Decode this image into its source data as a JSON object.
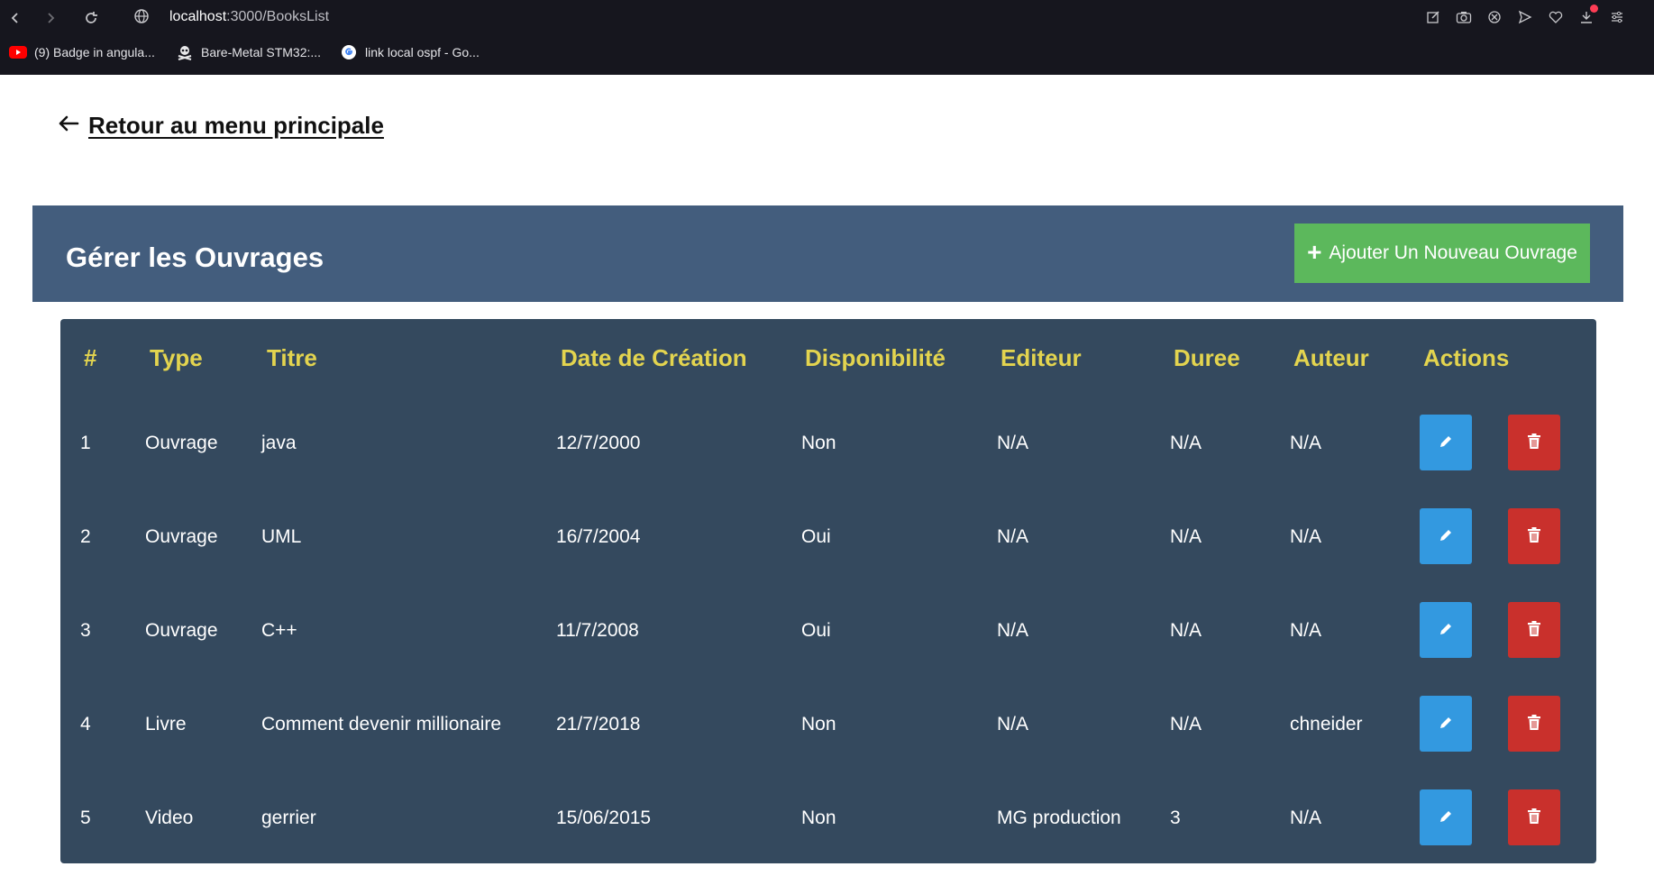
{
  "browser": {
    "url_host": "localhost",
    "url_path": ":3000/BooksList",
    "bookmarks": [
      {
        "label": "(9) Badge in angula..."
      },
      {
        "label": "Bare-Metal STM32:..."
      },
      {
        "label": "link local ospf - Go..."
      }
    ]
  },
  "page": {
    "back_label": " Retour au menu principale",
    "title": "Gérer les Ouvrages",
    "add_label": "Ajouter Un Nouveau Ouvrage",
    "add_icon": "+"
  },
  "table": {
    "headers": [
      "#",
      "Type",
      "Titre",
      "Date de Création",
      "Disponibilité",
      "Editeur",
      "Duree",
      "Auteur",
      "Actions"
    ],
    "rows": [
      {
        "id": "1",
        "type": "Ouvrage",
        "titre": "java",
        "date": "12/7/2000",
        "dispo": "Non",
        "editeur": "N/A",
        "duree": "N/A",
        "auteur": "N/A"
      },
      {
        "id": "2",
        "type": "Ouvrage",
        "titre": "UML",
        "date": "16/7/2004",
        "dispo": "Oui",
        "editeur": "N/A",
        "duree": "N/A",
        "auteur": "N/A"
      },
      {
        "id": "3",
        "type": "Ouvrage",
        "titre": "C++",
        "date": "11/7/2008",
        "dispo": "Oui",
        "editeur": "N/A",
        "duree": "N/A",
        "auteur": "N/A"
      },
      {
        "id": "4",
        "type": "Livre",
        "titre": "Comment devenir millionaire",
        "date": "21/7/2018",
        "dispo": "Non",
        "editeur": "N/A",
        "duree": "N/A",
        "auteur": "chneider"
      },
      {
        "id": "5",
        "type": "Video",
        "titre": "gerrier",
        "date": "15/06/2015",
        "dispo": "Non",
        "editeur": "MG production",
        "duree": "3",
        "auteur": "N/A"
      }
    ]
  },
  "colors": {
    "header_bar": "#435d7d",
    "table_bg": "#34495e",
    "header_text": "#e3d44f",
    "add_button": "#5cb85c",
    "edit_button": "#3399e0",
    "delete_button": "#c9302c"
  },
  "icons": {
    "back": "arrow-left-icon",
    "edit": "pencil-icon",
    "delete": "trash-icon"
  }
}
